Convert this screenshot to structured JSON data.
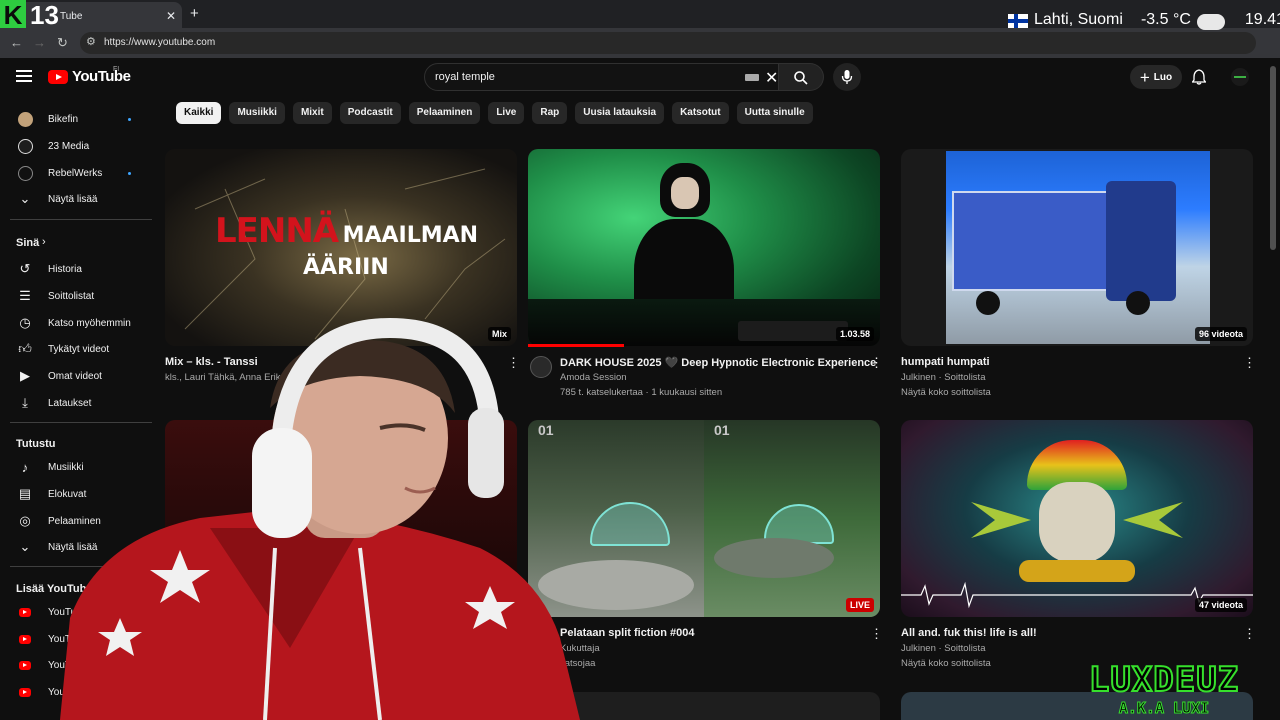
{
  "browser": {
    "tab_title": "Tube",
    "url": "https://www.youtube.com",
    "overlay_counter": "13"
  },
  "weather": {
    "location": "Lahti, Suomi",
    "temperature": "-3.5 °C",
    "time": "19.41"
  },
  "header": {
    "logo_text": "YouTube",
    "country_code": "FI",
    "search_value": "royal temple",
    "create_label": "Luo"
  },
  "sidebar": {
    "channels": [
      {
        "label": "Bikefin",
        "new": true
      },
      {
        "label": "23 Media",
        "new": false
      },
      {
        "label": "RebelWerks",
        "new": true
      }
    ],
    "show_more_1": "Näytä lisää",
    "you_heading": "Sinä",
    "you_items": [
      "Historia",
      "Soittolistat",
      "Katso myöhemmin",
      "Tykätyt videot",
      "Omat videot",
      "Lataukset"
    ],
    "explore_heading": "Tutustu",
    "explore_items": [
      "Musiikki",
      "Elokuvat",
      "Pelaaminen"
    ],
    "show_more_2": "Näytä lisää",
    "more_heading": "Lisää YouTubelta",
    "more_items": [
      "YouTube Premium",
      "YouTube Studi",
      "YouTube",
      "YouT"
    ]
  },
  "chips": [
    "Kaikki",
    "Musiikki",
    "Mixit",
    "Podcastit",
    "Pelaaminen",
    "Live",
    "Rap",
    "Uusia latauksia",
    "Katsotut",
    "Uutta sinulle"
  ],
  "videos": [
    {
      "title": "Mix – kls. - Tanssi",
      "meta1": "kls., Lauri Tähkä, Anna Eriksso",
      "meta2": "",
      "badge": "Mix",
      "thumb_text_red": "LENNÄ",
      "thumb_text_white": "MAAILMAN",
      "thumb_text_line2": "ÄÄRIIN"
    },
    {
      "title": "DARK HOUSE 2025 🖤 Deep Hypnotic Electronic Experience",
      "meta1": "Amoda Session",
      "meta2": "785 t. katselukertaa · 1 kuukausi sitten",
      "badge": "1.03.58"
    },
    {
      "title": "humpati humpati",
      "meta1": "Julkinen · Soittolista",
      "meta2": "Näytä koko soittolista",
      "badge": "96 videota"
    },
    {
      "title": "",
      "meta1": "",
      "meta2": "",
      "badge": ""
    },
    {
      "title": "Pelataan split fiction #004",
      "meta1": "Kukuttaja",
      "meta2": "katsojaa",
      "badge": "LIVE",
      "thumb_text": "01"
    },
    {
      "title": "All and. fuk this! life is all!",
      "meta1": "Julkinen · Soittolista",
      "meta2": "Näytä koko soittolista",
      "badge": "47 videota"
    }
  ],
  "streamer": {
    "name": "LUXDEUZ",
    "tagline": "A.K.A LUXI"
  },
  "colors": {
    "background": "#0f0f0f",
    "accent_red": "#ff0000",
    "chip_bg": "#272727",
    "lux_green": "#36e02c",
    "new_dot": "#3ea6ff"
  }
}
